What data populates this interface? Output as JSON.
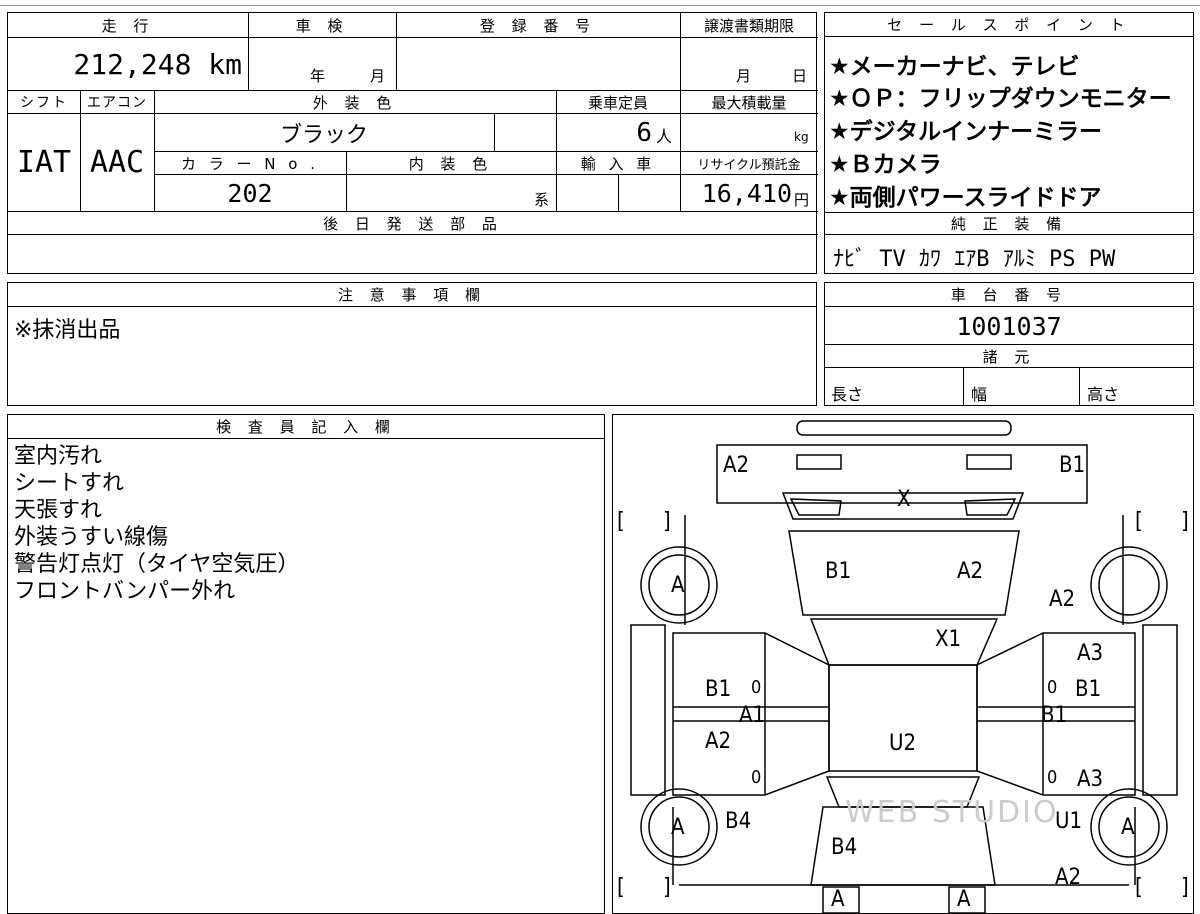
{
  "vehicle": {
    "mileage_label": "走 行",
    "mileage_value": "212,248 km",
    "inspection_label": "車 検",
    "inspection_year": "年",
    "inspection_month": "月",
    "registration_label": "登 録 番 号",
    "transfer_deadline_label": "譲渡書類期限",
    "transfer_month": "月",
    "transfer_day": "日",
    "shift_label": "シフト",
    "shift_value": "IAT",
    "aircon_label": "エアコン",
    "aircon_value": "AAC",
    "exterior_color_label": "外 装 色",
    "exterior_color_value": "ブラック",
    "capacity_label": "乗車定員",
    "capacity_value": "6",
    "capacity_unit": "人",
    "max_load_label": "最大積載量",
    "max_load_unit": "kg",
    "color_no_label": "カ ラ ー N o .",
    "color_no_value": "202",
    "interior_color_label": "内 装 色",
    "interior_suffix": "系",
    "import_label": "輸 入 車",
    "recycle_label": "リサイクル預託金",
    "recycle_value": "16,410",
    "recycle_unit": "円",
    "later_parts_label": "後 日 発 送 部 品"
  },
  "sales_points": {
    "title": "セ ー ル ス ポ イ ン ト",
    "items": [
      "★メーカーナビ、テレビ",
      "★ＯＰ：フリップダウンモニター",
      "★デジタルインナーミラー",
      "★Ｂカメラ",
      "★両側パワースライドドア"
    ]
  },
  "equipment": {
    "title": "純 正 装 備",
    "value": "ﾅﾋﾞ TV ｶﾜ ｴｱB ｱﾙﾐ PS PW"
  },
  "caution": {
    "title": "注 意 事 項 欄",
    "text": "※抹消出品"
  },
  "chassis": {
    "title": "車 台 番 号",
    "value": "1001037"
  },
  "specs": {
    "title": "諸 元",
    "length": "長さ",
    "width": "幅",
    "height": "高さ"
  },
  "inspector": {
    "title": "検 査 員 記 入 欄",
    "notes": [
      "室内汚れ",
      "シートすれ",
      "天張すれ",
      "外装うすい線傷",
      "警告灯点灯（タイヤ空気圧）",
      "フロントバンパー外れ"
    ]
  },
  "diagram": {
    "top_left": "A2",
    "top_right": "B1",
    "windshield": "X",
    "hood_left": "B1",
    "hood_right": "A2",
    "front_fender_right": "A2",
    "roof_front": "X1",
    "front_door_right": "A3",
    "front_door_left_damage": "B1",
    "front_door_left_count": "0",
    "left_sill": "A1",
    "front_door_right_count": "0",
    "front_door_right_damage": "B1",
    "right_sill": "B1",
    "rear_door_left": "A2",
    "roof": "U2",
    "rear_door_left_count": "0",
    "rear_door_right_count": "0",
    "rear_door_right": "A3",
    "rear_fender_left": "B4",
    "rear_fender_right": "U1",
    "tailgate": "B4",
    "rear_right": "A2",
    "wheel_fl": "A",
    "wheel_fr": "",
    "wheel_rl": "A",
    "wheel_rr": "A",
    "rear_bumper_left": "A",
    "rear_bumper_right": "A",
    "bracket_left": "[",
    "bracket_right": "]",
    "watermark": "WEB STUDIO"
  }
}
